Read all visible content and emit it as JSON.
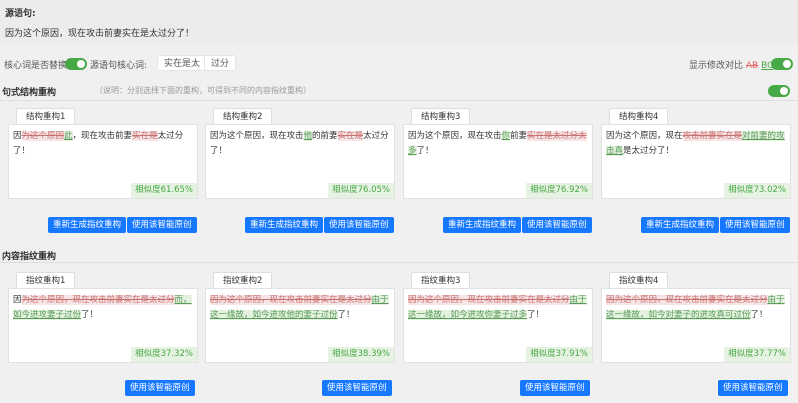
{
  "source": {
    "title": "源语句:",
    "text": "因为这个原因，现在攻击前妻实在是太过分了！"
  },
  "options": {
    "keyword_replace_label": "核心词是否替换",
    "source_keywords_label": "源语句核心词:",
    "keywords": [
      "实在是太",
      "过分"
    ],
    "show_diff_label": "显示修改对比",
    "diff_del_sample": "AB",
    "diff_ins_sample": "BC"
  },
  "structure_section": {
    "title": "句式结构重构",
    "note": "（说明：分别选择下面的重构，可得到不同的内容指纹重构）",
    "cards": [
      {
        "tab": "结构重构1",
        "segments": [
          {
            "t": "因",
            "k": "n"
          },
          {
            "t": "为这个原因",
            "k": "d"
          },
          {
            "t": "此",
            "k": "i"
          },
          {
            "t": "，现在攻击前妻",
            "k": "n"
          },
          {
            "t": "实在是",
            "k": "d"
          },
          {
            "t": "太过分了！",
            "k": "n"
          }
        ],
        "similarity": "相似度61.65%",
        "regen": "重新生成指纹重构",
        "use": "使用该智能原创"
      },
      {
        "tab": "结构重构2",
        "segments": [
          {
            "t": "因为这个原因，现在攻击",
            "k": "n"
          },
          {
            "t": "他",
            "k": "i"
          },
          {
            "t": "的前妻",
            "k": "n"
          },
          {
            "t": "实在是",
            "k": "d"
          },
          {
            "t": "太过分了！",
            "k": "n"
          }
        ],
        "similarity": "相似度76.05%",
        "regen": "重新生成指纹重构",
        "use": "使用该智能原创"
      },
      {
        "tab": "结构重构3",
        "segments": [
          {
            "t": "因为这个原因，现在攻击",
            "k": "n"
          },
          {
            "t": "你",
            "k": "i"
          },
          {
            "t": "前妻",
            "k": "n"
          },
          {
            "t": "实在是太过分太",
            "k": "d"
          },
          {
            "t": "多",
            "k": "i"
          },
          {
            "t": "了！",
            "k": "n"
          }
        ],
        "similarity": "相似度76.92%",
        "regen": "重新生成指纹重构",
        "use": "使用该智能原创"
      },
      {
        "tab": "结构重构4",
        "segments": [
          {
            "t": "因为这个原因，现在",
            "k": "n"
          },
          {
            "t": "攻击前妻实在是",
            "k": "d"
          },
          {
            "t": "对前妻的攻击真",
            "k": "i"
          },
          {
            "t": "是太过分了！",
            "k": "n"
          }
        ],
        "similarity": "相似度73.02%",
        "regen": "重新生成指纹重构",
        "use": "使用该智能原创"
      }
    ]
  },
  "content_section": {
    "title": "内容指纹重构",
    "cards": [
      {
        "tab": "指纹重构1",
        "segments": [
          {
            "t": "因",
            "k": "n"
          },
          {
            "t": "为这个原因，现在攻击前妻实在是太过分",
            "k": "d"
          },
          {
            "t": "而，如今进攻妻子过份",
            "k": "i"
          },
          {
            "t": "了！",
            "k": "n"
          }
        ],
        "similarity": "相似度37.32%",
        "use": "使用该智能原创"
      },
      {
        "tab": "指纹重构2",
        "segments": [
          {
            "t": "因为这个原因，现在攻击前妻实在是太过分",
            "k": "d"
          },
          {
            "t": "由于这一缘故，如今进攻他的妻子过份",
            "k": "i"
          },
          {
            "t": "了！",
            "k": "n"
          }
        ],
        "similarity": "相似度38.39%",
        "use": "使用该智能原创"
      },
      {
        "tab": "指纹重构3",
        "segments": [
          {
            "t": "因为这个原因，现在攻击前妻实在是太过分",
            "k": "d"
          },
          {
            "t": "由于这一缘故，如今进攻你妻子过多",
            "k": "i"
          },
          {
            "t": "了！",
            "k": "n"
          }
        ],
        "similarity": "相似度37.91%",
        "use": "使用该智能原创"
      },
      {
        "tab": "指纹重构4",
        "segments": [
          {
            "t": "因为这个原因，现在攻击前妻实在是太过分",
            "k": "d"
          },
          {
            "t": "由于这一缘故，如今对妻子的进攻真可过份",
            "k": "i"
          },
          {
            "t": "了！",
            "k": "n"
          }
        ],
        "similarity": "相似度37.77%",
        "use": "使用该智能原创"
      }
    ]
  },
  "colors": {
    "accent": "#1677ff",
    "toggle_on": "#47a846",
    "deleted": "#e06666",
    "inserted": "#47a846"
  }
}
